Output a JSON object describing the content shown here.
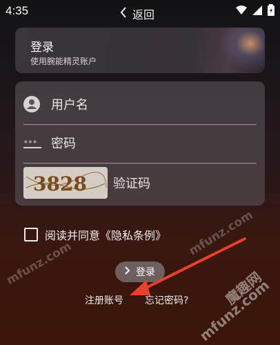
{
  "status": {
    "time": "4:35",
    "icons": [
      "wifi-icon",
      "signal-icon",
      "battery-icon"
    ]
  },
  "nav": {
    "back_label": "返回",
    "back_icon": "chevron-left-icon"
  },
  "header_card": {
    "title": "登录",
    "subtitle": "使用腕能精灵账户"
  },
  "form": {
    "username_placeholder": "用户名",
    "password_placeholder": "密码",
    "captcha_placeholder": "验证码",
    "captcha_text": "3828"
  },
  "agreement": {
    "label": "阅读并同意《隐私条例》",
    "checked": false
  },
  "actions": {
    "login_label": "登录",
    "register_label": "注册账号",
    "forgot_label": "忘记密码?"
  },
  "watermark": {
    "latin": "mfunz.com",
    "cjk": "魔趣网"
  },
  "colors": {
    "background_top": "#121214",
    "background_bottom": "#3b1508",
    "arrow": "#e8402c"
  }
}
